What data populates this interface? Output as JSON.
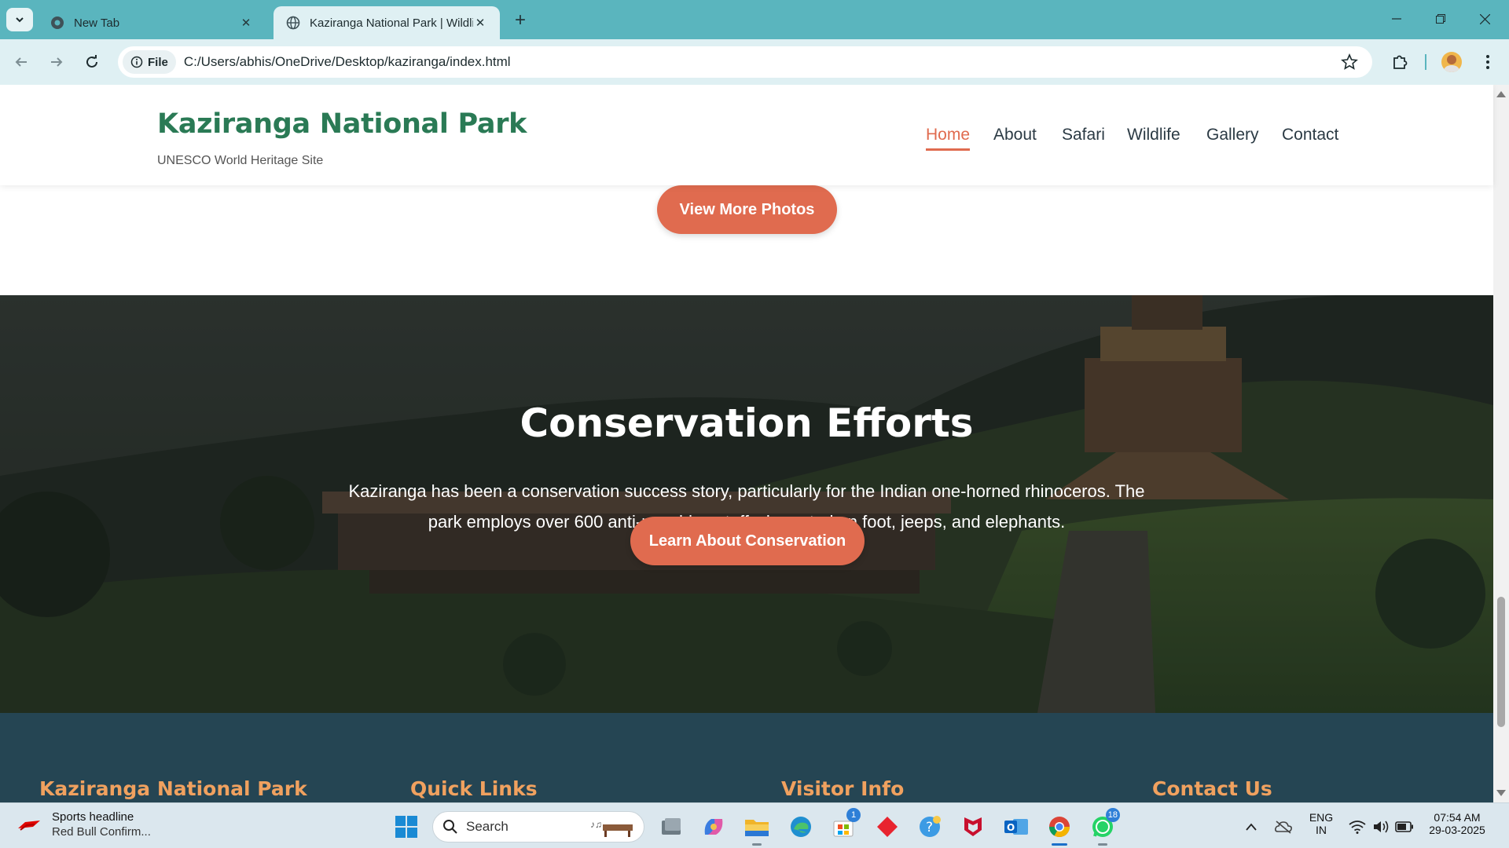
{
  "browser": {
    "tabs": [
      {
        "title": "New Tab",
        "active": false
      },
      {
        "title": "Kaziranga National Park | Wildlife Sanctuary",
        "active": true
      }
    ],
    "address": {
      "chip_label": "File",
      "url": "C:/Users/abhis/OneDrive/Desktop/kaziranga/index.html"
    }
  },
  "site": {
    "logo": "Kaziranga National Park",
    "tagline": "UNESCO World Heritage Site",
    "nav": [
      "Home",
      "About",
      "Safari",
      "Wildlife",
      "Gallery",
      "Contact"
    ],
    "active_nav": "Home",
    "gallery_button": "View More Photos",
    "conservation": {
      "title": "Conservation Efforts",
      "text": "Kaziranga has been a conservation success story, particularly for the Indian one-horned rhinoceros. The park employs over 600 anti-poaching staff who patrol on foot, jeeps, and elephants.",
      "button": "Learn About Conservation"
    },
    "footer_headings": [
      "Kaziranga National Park",
      "Quick Links",
      "Visitor Info",
      "Contact Us"
    ],
    "colors": {
      "brand_green": "#2a7a55",
      "accent": "#e06b4f",
      "footer_bg": "#254553",
      "footer_heading": "#f0a15f"
    }
  },
  "taskbar": {
    "news_title": "Sports headline",
    "news_sub": "Red Bull Confirm...",
    "search_placeholder": "Search",
    "badges": {
      "store": "1",
      "whatsapp": "18"
    },
    "lang_top": "ENG",
    "lang_bottom": "IN",
    "time": "07:54 AM",
    "date": "29-03-2025"
  }
}
